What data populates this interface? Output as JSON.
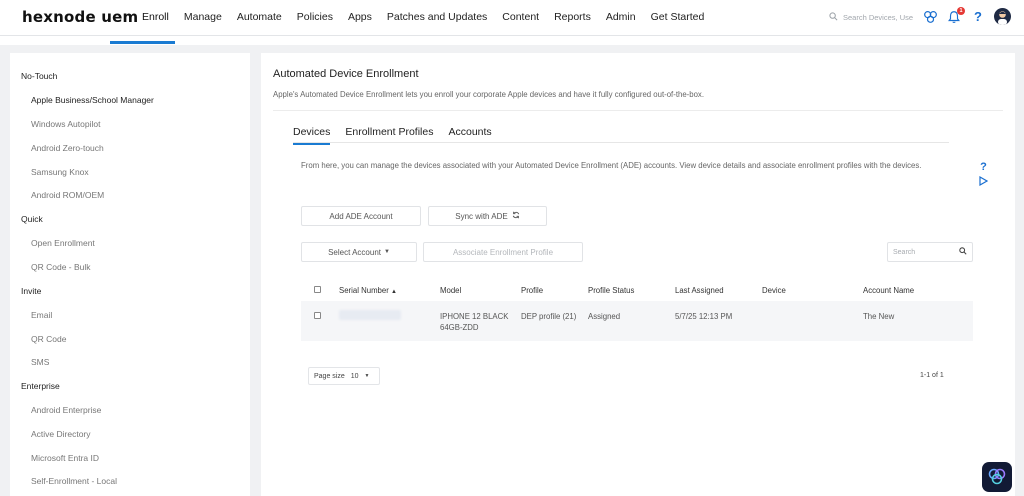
{
  "brand": {
    "logo": "hexnode uem"
  },
  "nav": {
    "items": [
      "Enroll",
      "Manage",
      "Automate",
      "Policies",
      "Apps",
      "Patches and Updates",
      "Content",
      "Reports",
      "Admin",
      "Get Started"
    ],
    "active": "Enroll"
  },
  "topbar": {
    "search_placeholder": "Search Devices, Use",
    "notification_count": "1",
    "help_label": "?"
  },
  "sidebar": {
    "groups": [
      {
        "label": "No-Touch",
        "items": [
          "Apple Business/School Manager",
          "Windows Autopilot",
          "Android Zero-touch",
          "Samsung Knox",
          "Android ROM/OEM"
        ]
      },
      {
        "label": "Quick",
        "items": [
          "Open Enrollment",
          "QR Code - Bulk"
        ]
      },
      {
        "label": "Invite",
        "items": [
          "Email",
          "QR Code",
          "SMS"
        ]
      },
      {
        "label": "Enterprise",
        "items": [
          "Android Enterprise",
          "Active Directory",
          "Microsoft Entra ID",
          "Self-Enrollment - Local"
        ]
      }
    ],
    "selected": "Apple Business/School Manager"
  },
  "main": {
    "title": "Automated Device Enrollment",
    "description": "Apple's Automated Device Enrollment lets you enroll your corporate Apple devices and have it fully configured out-of-the-box.",
    "tabs": [
      "Devices",
      "Enrollment Profiles",
      "Accounts"
    ],
    "active_tab": "Devices",
    "info": "From here, you can manage the devices associated with your Automated Device Enrollment (ADE) accounts. View device details and associate enrollment profiles with the devices.",
    "buttons": {
      "add_account": "Add ADE Account",
      "sync": "Sync with ADE",
      "select_account": "Select Account",
      "associate": "Associate Enrollment Profile"
    },
    "search_placeholder": "Search",
    "table": {
      "headers": [
        "Serial Number",
        "Model",
        "Profile",
        "Profile Status",
        "Last Assigned",
        "Device",
        "Account Name"
      ],
      "rows": [
        {
          "serial": "",
          "model_line1": "IPHONE 12 BLACK",
          "model_line2": "64GB-ZDD",
          "profile": "DEP profile (21)",
          "profile_status": "Assigned",
          "last_assigned": "5/7/25 12:13 PM",
          "device": "",
          "account_name": "The New"
        }
      ]
    },
    "pagination": {
      "page_size_label": "Page size",
      "page_size": "10",
      "range": "1-1 of 1"
    }
  },
  "colors": {
    "accent": "#1a7bd2",
    "chat_bg": "#121a35"
  }
}
